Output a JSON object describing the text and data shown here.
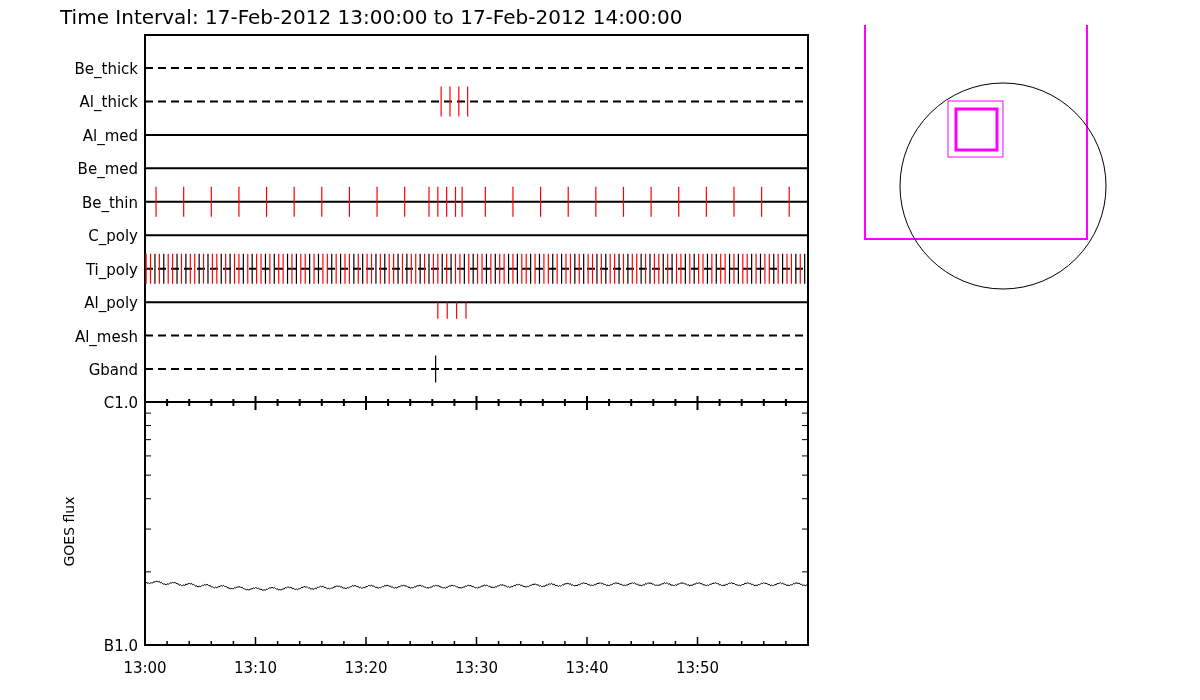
{
  "title": "Time Interval: 17-Feb-2012 13:00:00 to 17-Feb-2012 14:00:00",
  "channels": [
    {
      "label": "Be_thick",
      "kind": "dashed"
    },
    {
      "label": "Al_thick",
      "kind": "dashed"
    },
    {
      "label": "Al_med",
      "kind": "solid"
    },
    {
      "label": "Be_med",
      "kind": "solid"
    },
    {
      "label": "Be_thin",
      "kind": "solid"
    },
    {
      "label": "C_poly",
      "kind": "solid"
    },
    {
      "label": "Ti_poly",
      "kind": "dashed"
    },
    {
      "label": "Al_poly",
      "kind": "solid"
    },
    {
      "label": "Al_mesh",
      "kind": "dashed"
    },
    {
      "label": "Gband",
      "kind": "dashed"
    }
  ],
  "goes": {
    "y_axis_title": "GOES flux",
    "x_axis_labels": [
      "13:00",
      "13:10",
      "13:20",
      "13:30",
      "13:40",
      "13:50"
    ],
    "y_axis_labels": [
      "C1.0",
      "B1.0"
    ]
  }
}
